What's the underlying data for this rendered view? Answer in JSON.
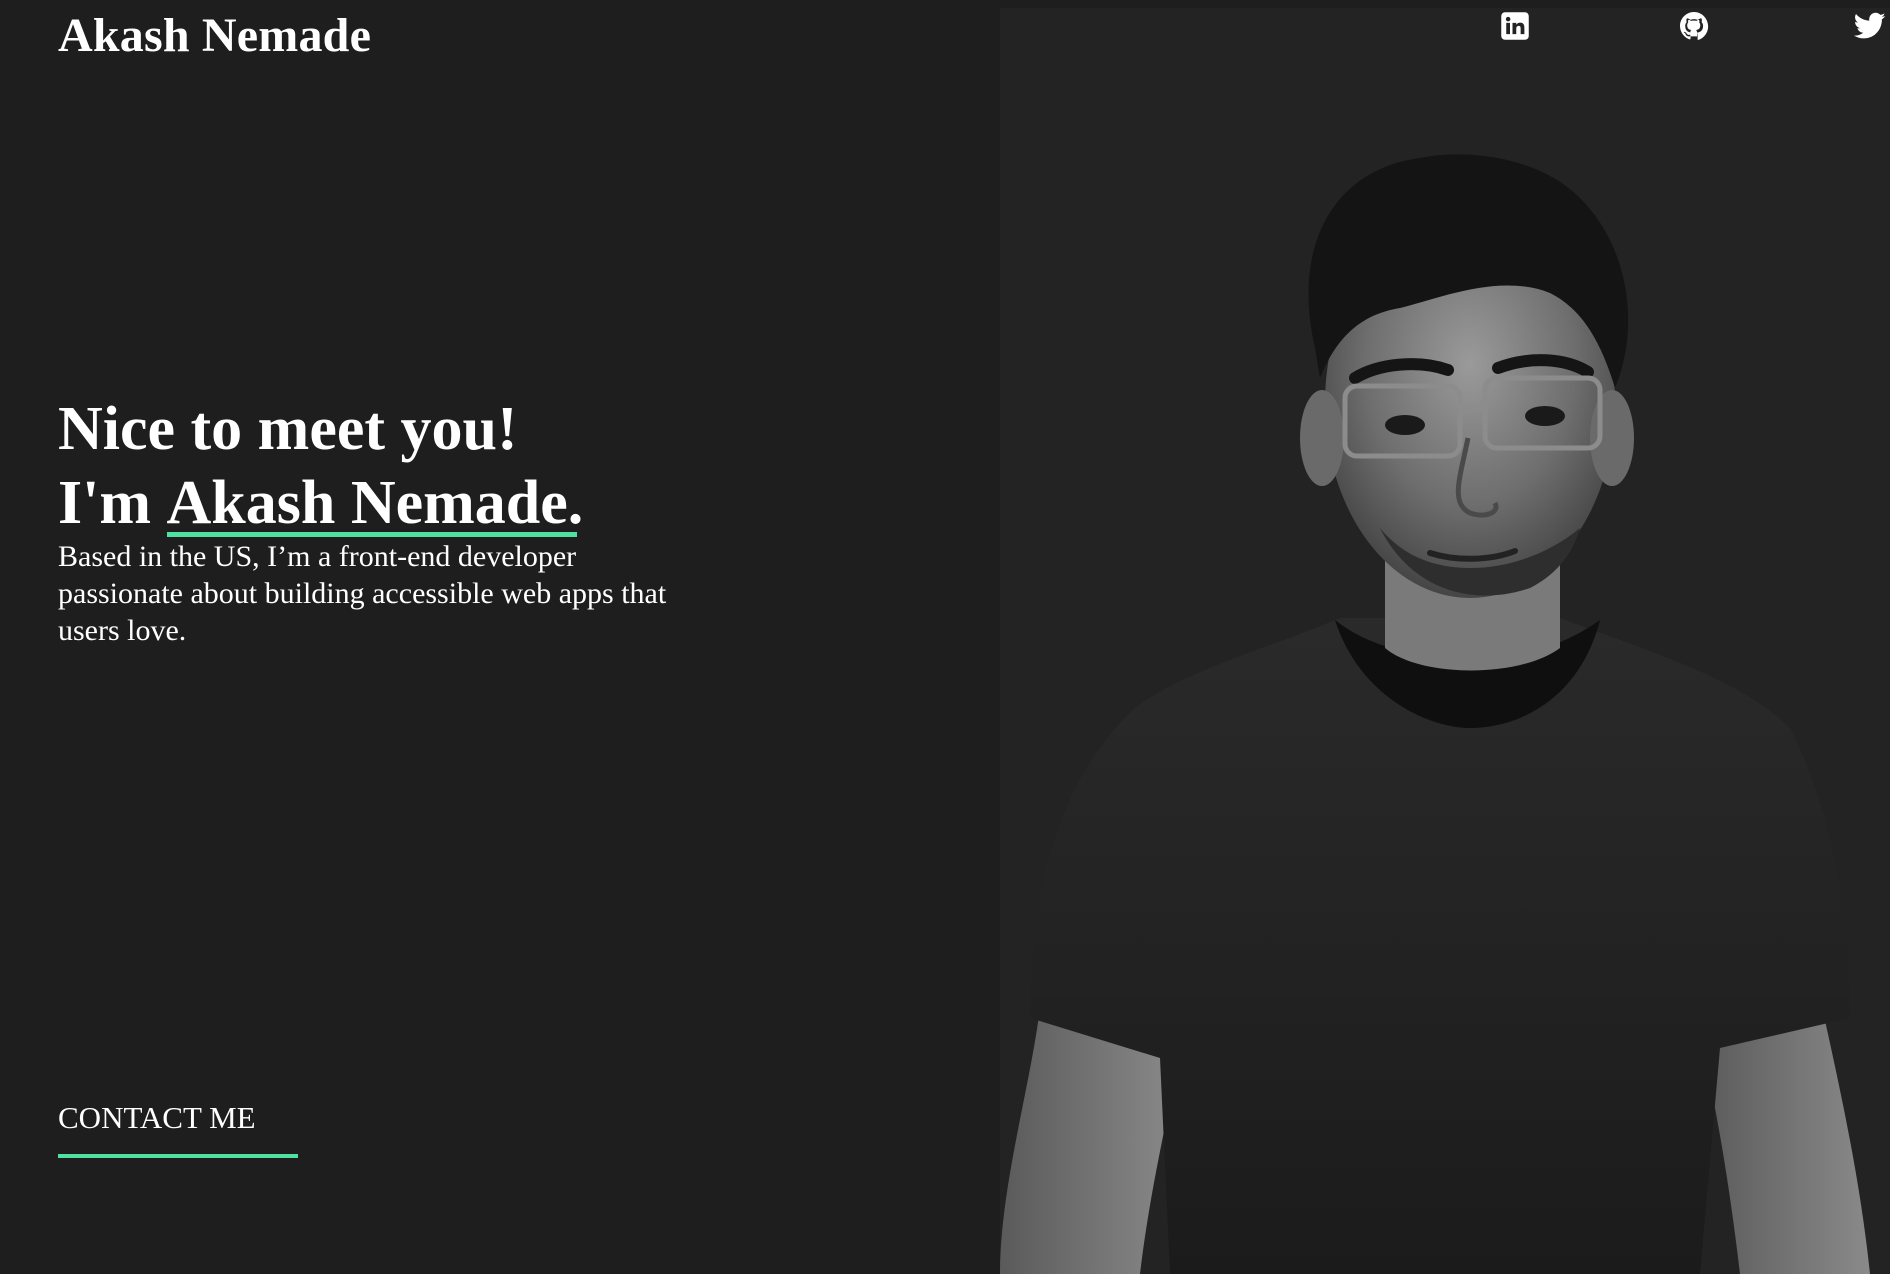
{
  "site": {
    "logo_text": "Akash Nemade"
  },
  "social": [
    {
      "name": "linkedin",
      "icon": "linkedin-icon"
    },
    {
      "name": "github",
      "icon": "github-icon"
    },
    {
      "name": "twitter",
      "icon": "twitter-icon"
    }
  ],
  "hero": {
    "greeting": "Nice to meet you!",
    "intro_prefix": "I'm ",
    "intro_name": "Akash Nemade.",
    "description": "Based in the US, I’m a front-end developer passionate about building accessible web apps that users love."
  },
  "cta": {
    "contact_label": "CONTACT ME"
  },
  "photo": {
    "subject": "portrait-photo",
    "style": "grayscale"
  },
  "colors": {
    "background": "#1e1e1f",
    "photo_panel": "#232324",
    "text": "#ffffff",
    "accent": "#4ee1a0"
  }
}
